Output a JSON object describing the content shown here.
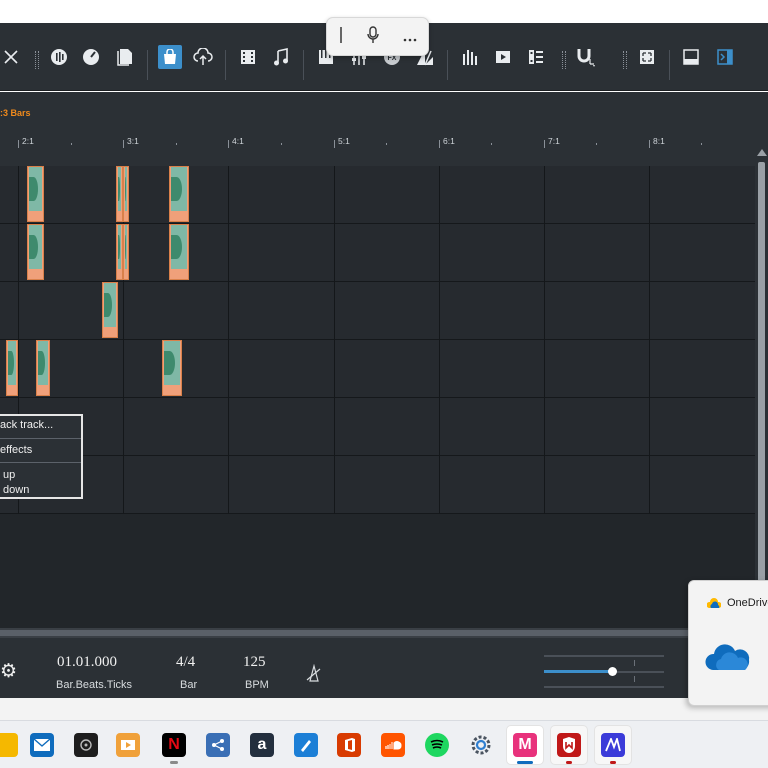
{
  "colors": {
    "app_bg": "#22262a",
    "toolbar_bg": "#2b3035",
    "accent_blue": "#3c8fcb",
    "loop_orange": "#f08a1c",
    "clip_salmon": "#f0a07a",
    "clip_wave_green": "#3e8a6d"
  },
  "toolbar": {
    "icons": [
      "close-icon",
      "audio-record-icon",
      "tempo-dial-icon",
      "file-icon",
      "shop-bag-icon",
      "cloud-upload-icon",
      "film-icon",
      "music-note-icon",
      "piano-icon",
      "mixer-icon",
      "fx-icon",
      "fan-icon",
      "bars-icon",
      "play-video-icon",
      "list-film-icon",
      "snap-magnet-icon",
      "fullscreen-icon",
      "panel-bottom-icon",
      "panel-right-icon"
    ],
    "fx_label": "FX"
  },
  "voice_typing": {
    "icons": [
      "cursor-bar-icon",
      "microphone-icon",
      "more-icon"
    ]
  },
  "ruler": {
    "loop_label": "3 Bars",
    "bars": [
      "2:1",
      "3:1",
      "4:1",
      "5:1",
      "6:1",
      "7:1",
      "8:1"
    ]
  },
  "context_menu": {
    "items": [
      "ack track...",
      "effects",
      " up",
      " down"
    ]
  },
  "transport": {
    "position_value": "01.01.000",
    "position_label": "Bar.Beats.Ticks",
    "signature_value": "4/4",
    "signature_label": "Bar",
    "tempo_value": "125",
    "tempo_label": "BPM",
    "volume_level": 0.57
  },
  "onedrive": {
    "title": "OneDrive"
  },
  "taskbar": {
    "apps": [
      "file-explorer-icon",
      "mail-icon",
      "media-app-icon",
      "video-editor-icon",
      "netflix-icon",
      "share-icon",
      "amazon-icon",
      "pen-app-icon",
      "office-icon",
      "soundcloud-icon",
      "spotify-icon",
      "settings-icon",
      "music-maker-icon",
      "mcafee-icon",
      "magix-icon"
    ],
    "netflix_label": "N",
    "amazon_label": "a",
    "music_maker_label": "M"
  }
}
